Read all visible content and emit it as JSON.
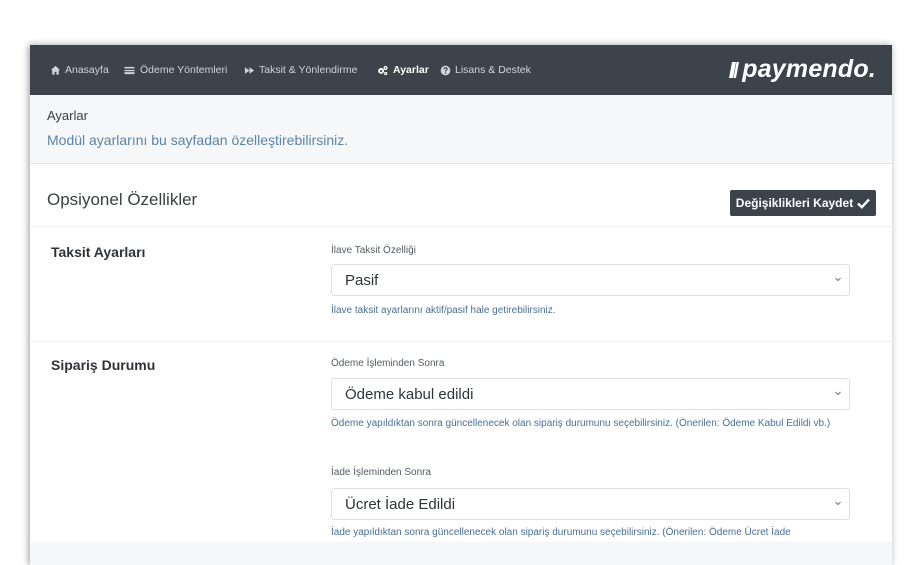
{
  "nav": {
    "items": [
      {
        "label": "Anasayfa",
        "icon": "home-icon"
      },
      {
        "label": "Ödeme Yöntemleri",
        "icon": "credit-card-icon"
      },
      {
        "label": "Taksit & Yönlendirme",
        "icon": "fast-forward-icon"
      },
      {
        "label": "Ayarlar",
        "icon": "cogs-icon",
        "active": true
      },
      {
        "label": "Lisans & Destek",
        "icon": "question-circle-icon"
      }
    ],
    "logo_text": "paymendo."
  },
  "header": {
    "title": "Ayarlar",
    "subtitle": "Modül ayarlarını bu sayfadan özelleştirebilirsiniz."
  },
  "section": {
    "title": "Opsiyonel Özellikler",
    "save_label": "Değişiklikleri Kaydet"
  },
  "taksit": {
    "title": "Taksit Ayarları",
    "field_label": "İlave Taksit Özelliği",
    "value": "Pasif",
    "help": "İlave taksit ayarlarını aktif/pasif hale getirebilirsiniz."
  },
  "siparis": {
    "title": "Sipariş Durumu",
    "odeme_label": "Ödeme İşleminden Sonra",
    "odeme_value": "Ödeme kabul edildi",
    "odeme_help": "Ödeme yapıldıktan sonra güncellenecek olan sipariş durumunu seçebilirsiniz. (Önerilen: Ödeme Kabul Edildi vb.)",
    "iade_label": "İade İşleminden Sonra",
    "iade_value": "Ücret İade Edildi",
    "iade_help": "İade yapıldıktan sonra güncellenecek olan sipariş durumunu seçebilirsiniz. (Önerilen: Ödeme Ücret İade"
  },
  "colors": {
    "nav_bg": "#3d434a",
    "header_bg": "#f5f7f9",
    "help_text": "#4a6f94",
    "subtitle_text": "#5b84a8"
  }
}
